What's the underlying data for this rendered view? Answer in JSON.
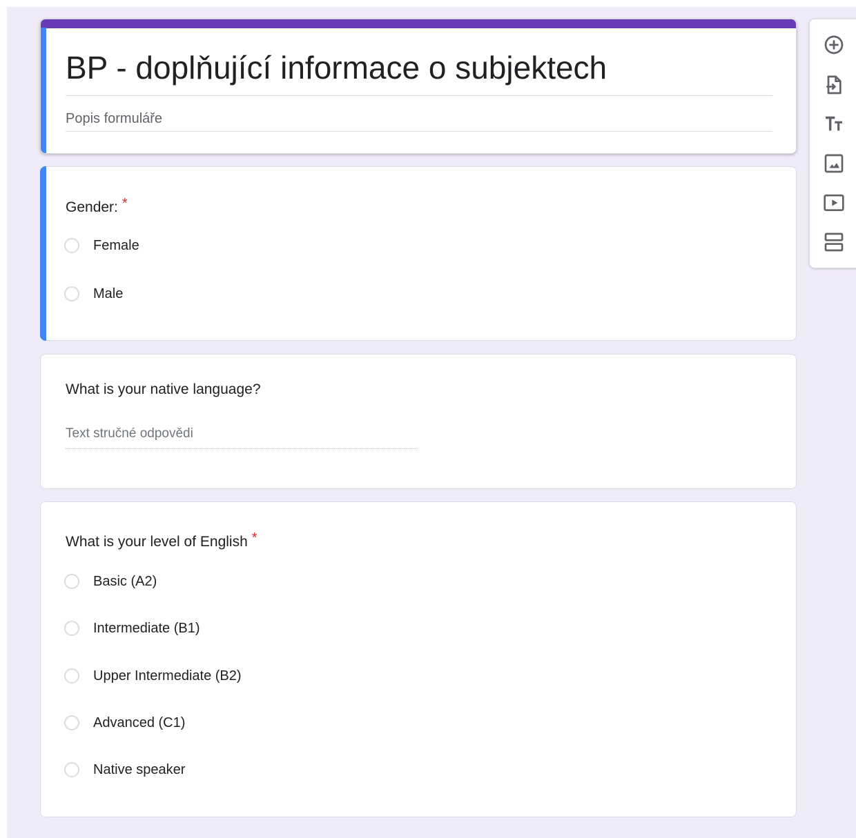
{
  "form": {
    "title": "BP - doplňující informace o subjektech",
    "description_placeholder": "Popis formuláře"
  },
  "questions": [
    {
      "title": "Gender:",
      "required_mark": "*",
      "options": [
        "Female",
        "Male"
      ]
    },
    {
      "title": "What is your native language?",
      "answer_placeholder": "Text stručné odpovědi"
    },
    {
      "title": "What is your level of English",
      "required_mark": "*",
      "options": [
        "Basic (A2)",
        "Intermediate (B1)",
        "Upper Intermediate (B2)",
        "Advanced (C1)",
        "Native speaker"
      ]
    }
  ],
  "toolbar": {
    "icons": [
      "add-question-icon",
      "import-questions-icon",
      "add-title-icon",
      "add-image-icon",
      "add-video-icon",
      "add-section-icon"
    ]
  },
  "colors": {
    "theme": "#673ab7",
    "active_accent": "#4285f4",
    "background": "#f0ebf8",
    "required": "#d93025"
  }
}
